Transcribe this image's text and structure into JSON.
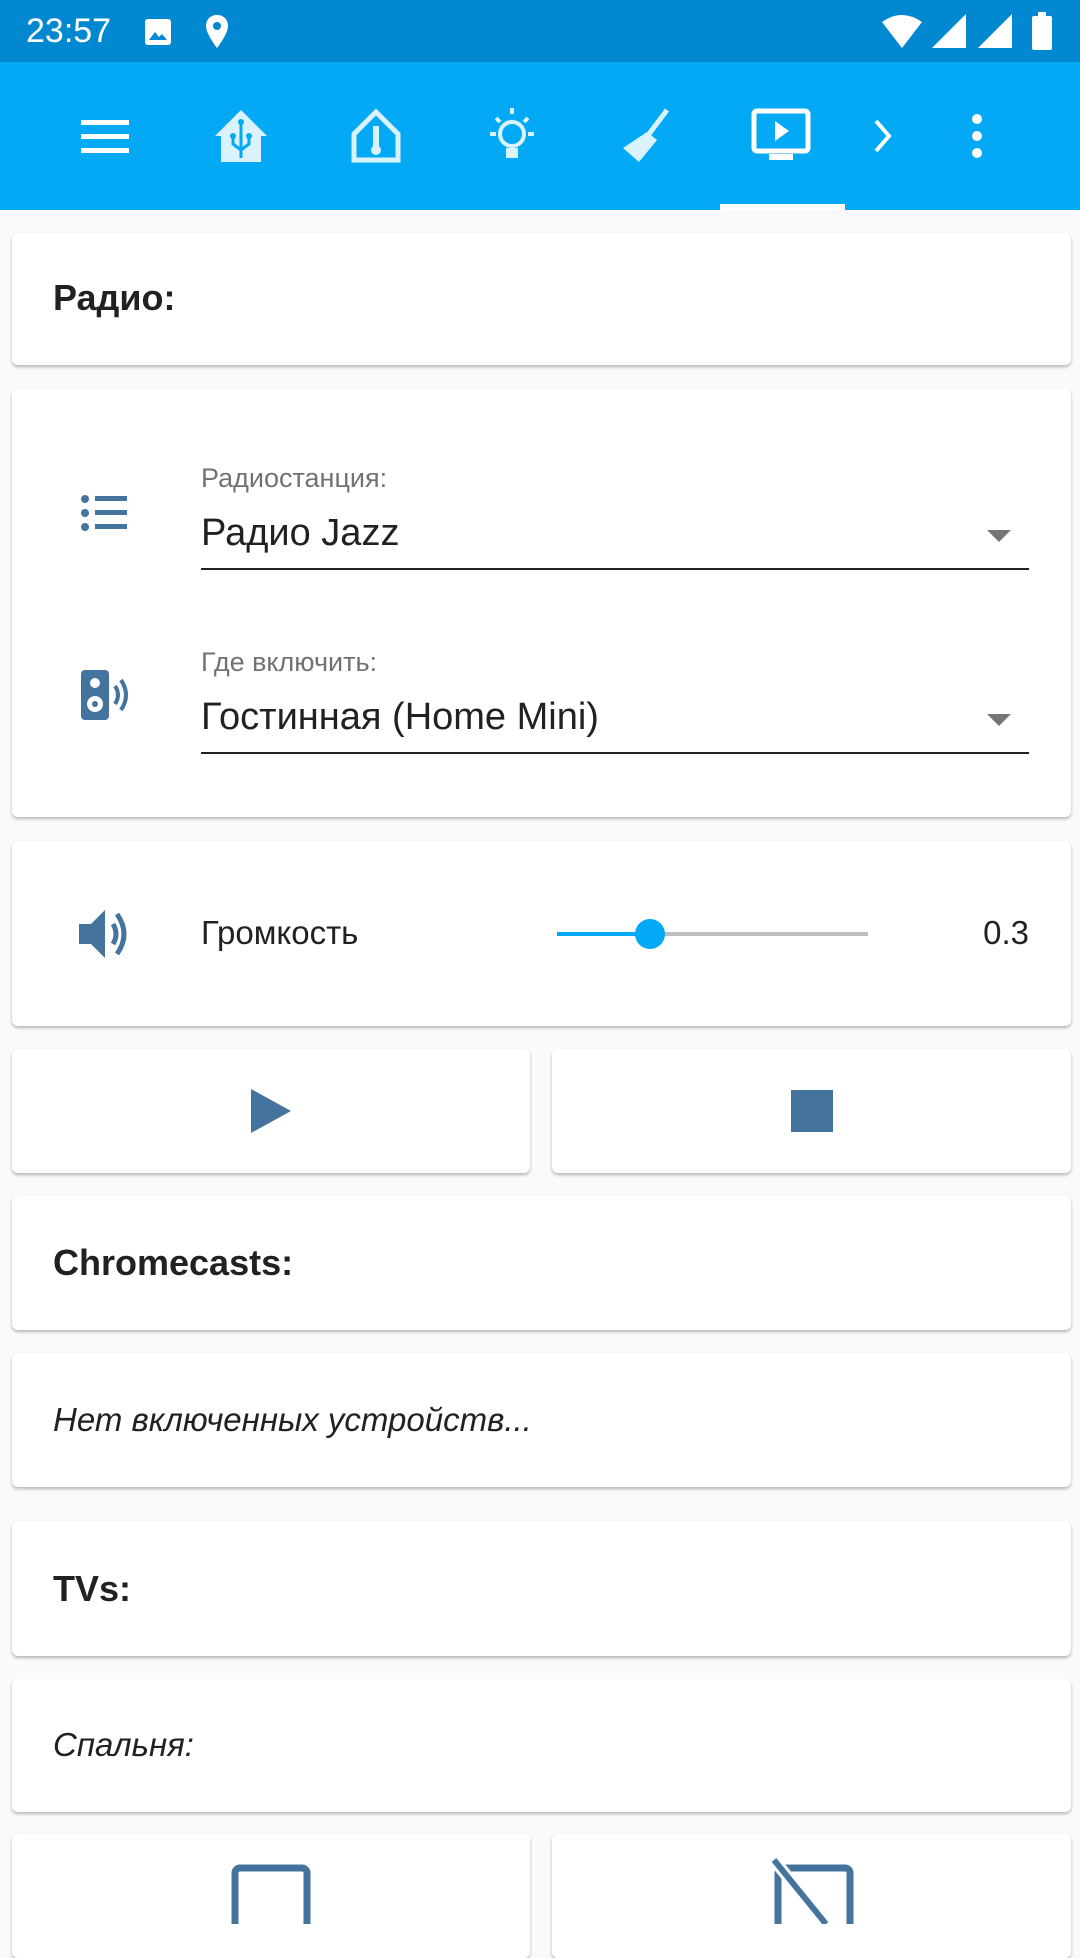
{
  "status_bar": {
    "time": "23:57",
    "icons": [
      "image-icon",
      "location-icon",
      "wifi-icon",
      "signal-icon",
      "signal-icon",
      "battery-icon"
    ]
  },
  "toolbar": {
    "tabs": [
      "menu-icon",
      "home-assistant-icon",
      "home-thermometer-icon",
      "lightbulb-icon",
      "broom-icon",
      "television-play-icon"
    ],
    "active_tab": 5,
    "accent": "#03a9f4"
  },
  "radio": {
    "title": "Радио:",
    "station_label": "Радиостанция:",
    "station_value": "Радио Jazz",
    "where_label": "Где включить:",
    "where_value": "Гостинная (Home Mini)",
    "volume_label": "Громкость",
    "volume_value": "0.3",
    "volume_fraction": 0.3
  },
  "chromecasts": {
    "title": "Chromecasts:",
    "empty_text": "Нет включенных устройств..."
  },
  "tvs": {
    "title": "TVs:",
    "bedroom_label": "Спальня:"
  },
  "icon_color": "#44739e"
}
